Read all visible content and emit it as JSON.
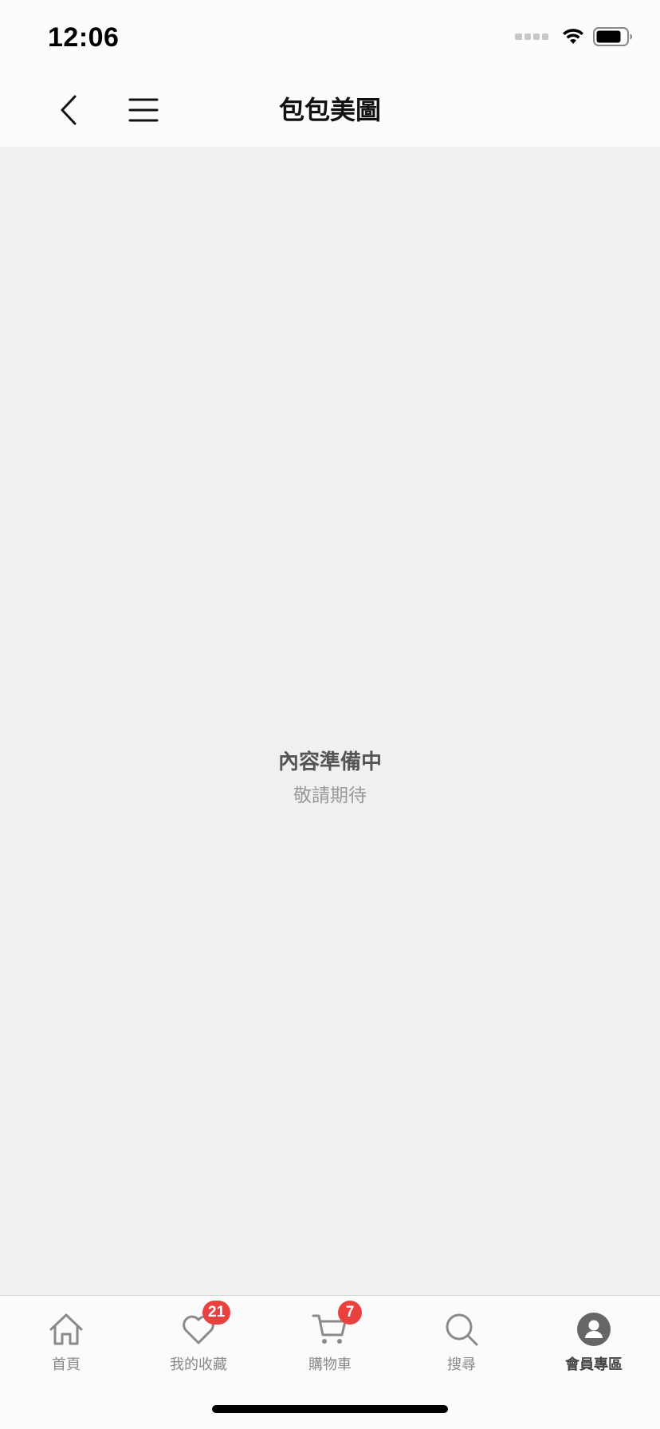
{
  "status_bar": {
    "time": "12:06"
  },
  "nav": {
    "title": "包包美圖",
    "back_icon": "chevron-left-icon",
    "menu_icon": "hamburger-menu-icon"
  },
  "content": {
    "empty_title": "內容準備中",
    "empty_subtitle": "敬請期待"
  },
  "tab_bar": {
    "tabs": [
      {
        "label": "首頁",
        "icon": "home-icon",
        "badge": null,
        "active": false
      },
      {
        "label": "我的收藏",
        "icon": "heart-icon",
        "badge": "21",
        "active": false
      },
      {
        "label": "購物車",
        "icon": "cart-icon",
        "badge": "7",
        "active": false
      },
      {
        "label": "搜尋",
        "icon": "search-icon",
        "badge": null,
        "active": false
      },
      {
        "label": "會員專區",
        "icon": "user-icon",
        "badge": null,
        "active": true
      }
    ]
  },
  "colors": {
    "badge": "#e8413e",
    "background": "#f0f0f0",
    "bar": "#fdfcfd"
  }
}
